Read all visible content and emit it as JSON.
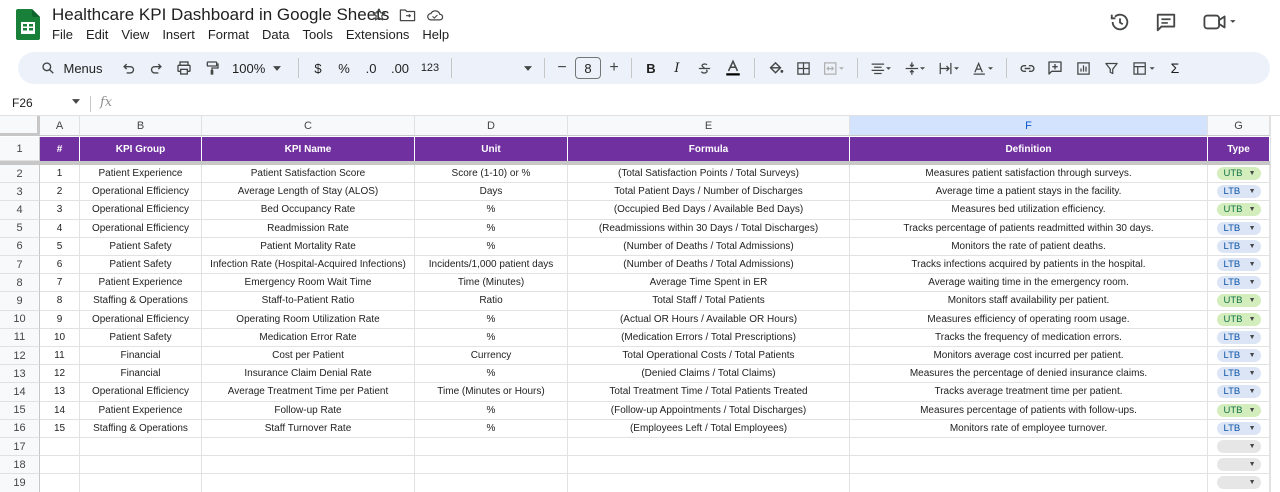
{
  "document": {
    "title": "Healthcare KPI Dashboard in Google Sheets",
    "menu": [
      "File",
      "Edit",
      "View",
      "Insert",
      "Format",
      "Data",
      "Tools",
      "Extensions",
      "Help"
    ]
  },
  "toolbar": {
    "search_label": "Menus",
    "zoom": "100%",
    "currency": "$",
    "percent": "%",
    "decrease_decimal": ".0",
    "increase_decimal": ".00",
    "number_format": "123",
    "font_size": "8",
    "minus": "−",
    "plus": "+",
    "bold": "B",
    "italic": "I",
    "sum": "Σ"
  },
  "formula_bar": {
    "cell_ref": "F26",
    "fx": "fx"
  },
  "columns": [
    "A",
    "B",
    "C",
    "D",
    "E",
    "F",
    "G"
  ],
  "selected_column": "F",
  "header_row": [
    "#",
    "KPI Group",
    "KPI Name",
    "Unit",
    "Formula",
    "Definition",
    "Type"
  ],
  "rows": [
    {
      "n": "1",
      "group": "Patient Experience",
      "name": "Patient Satisfaction Score",
      "unit": "Score (1-10) or %",
      "formula": "(Total Satisfaction Points / Total Surveys)",
      "definition": "Measures patient satisfaction through surveys.",
      "type": "UTB"
    },
    {
      "n": "2",
      "group": "Operational Efficiency",
      "name": "Average Length of Stay (ALOS)",
      "unit": "Days",
      "formula": "Total Patient Days / Number of Discharges",
      "definition": "Average time a patient stays in the facility.",
      "type": "LTB"
    },
    {
      "n": "3",
      "group": "Operational Efficiency",
      "name": "Bed Occupancy Rate",
      "unit": "%",
      "formula": "(Occupied Bed Days / Available Bed Days)",
      "definition": "Measures bed utilization efficiency.",
      "type": "UTB"
    },
    {
      "n": "4",
      "group": "Operational Efficiency",
      "name": "Readmission Rate",
      "unit": "%",
      "formula": "(Readmissions within 30 Days / Total Discharges)",
      "definition": "Tracks percentage of patients readmitted within 30 days.",
      "type": "LTB"
    },
    {
      "n": "5",
      "group": "Patient Safety",
      "name": "Patient Mortality Rate",
      "unit": "%",
      "formula": "(Number of Deaths / Total Admissions)",
      "definition": "Monitors the rate of patient deaths.",
      "type": "LTB"
    },
    {
      "n": "6",
      "group": "Patient Safety",
      "name": "Infection Rate (Hospital-Acquired Infections)",
      "unit": "Incidents/1,000 patient days",
      "formula": "(Number of Deaths / Total Admissions)",
      "definition": "Tracks infections acquired by patients in the hospital.",
      "type": "LTB"
    },
    {
      "n": "7",
      "group": "Patient Experience",
      "name": "Emergency Room Wait Time",
      "unit": "Time (Minutes)",
      "formula": "Average Time Spent in ER",
      "definition": "Average waiting time in the emergency room.",
      "type": "LTB"
    },
    {
      "n": "8",
      "group": "Staffing & Operations",
      "name": "Staff-to-Patient Ratio",
      "unit": "Ratio",
      "formula": "Total Staff / Total Patients",
      "definition": "Monitors staff availability per patient.",
      "type": "UTB"
    },
    {
      "n": "9",
      "group": "Operational Efficiency",
      "name": "Operating Room Utilization Rate",
      "unit": "%",
      "formula": "(Actual OR Hours / Available OR Hours)",
      "definition": "Measures efficiency of operating room usage.",
      "type": "UTB"
    },
    {
      "n": "10",
      "group": "Patient Safety",
      "name": "Medication Error Rate",
      "unit": "%",
      "formula": "(Medication Errors / Total Prescriptions)",
      "definition": "Tracks the frequency of medication errors.",
      "type": "LTB"
    },
    {
      "n": "11",
      "group": "Financial",
      "name": "Cost per Patient",
      "unit": "Currency",
      "formula": "Total Operational Costs / Total Patients",
      "definition": "Monitors average cost incurred per patient.",
      "type": "LTB"
    },
    {
      "n": "12",
      "group": "Financial",
      "name": "Insurance Claim Denial Rate",
      "unit": "%",
      "formula": "(Denied Claims / Total Claims)",
      "definition": "Measures the percentage of denied insurance claims.",
      "type": "LTB"
    },
    {
      "n": "13",
      "group": "Operational Efficiency",
      "name": "Average Treatment Time per Patient",
      "unit": "Time (Minutes or Hours)",
      "formula": "Total Treatment Time / Total Patients Treated",
      "definition": "Tracks average treatment time per patient.",
      "type": "LTB"
    },
    {
      "n": "14",
      "group": "Patient Experience",
      "name": "Follow-up Rate",
      "unit": "%",
      "formula": "(Follow-up Appointments / Total Discharges)",
      "definition": "Measures percentage of patients with follow-ups.",
      "type": "UTB"
    },
    {
      "n": "15",
      "group": "Staffing & Operations",
      "name": "Staff Turnover Rate",
      "unit": "%",
      "formula": "(Employees Left / Total Employees)",
      "definition": "Monitors rate of employee turnover.",
      "type": "LTB"
    }
  ],
  "row_numbers": [
    "1",
    "2",
    "3",
    "4",
    "5",
    "6",
    "7",
    "8",
    "9",
    "10",
    "11",
    "12",
    "13",
    "14",
    "15",
    "16",
    "17",
    "18",
    "19"
  ],
  "colors": {
    "header_purple": "#7030a0",
    "utb_chip": "#d4edbc",
    "ltb_chip": "#dbe5f5",
    "sheets_green": "#188038",
    "toolbar_bg": "#edf2fa"
  }
}
